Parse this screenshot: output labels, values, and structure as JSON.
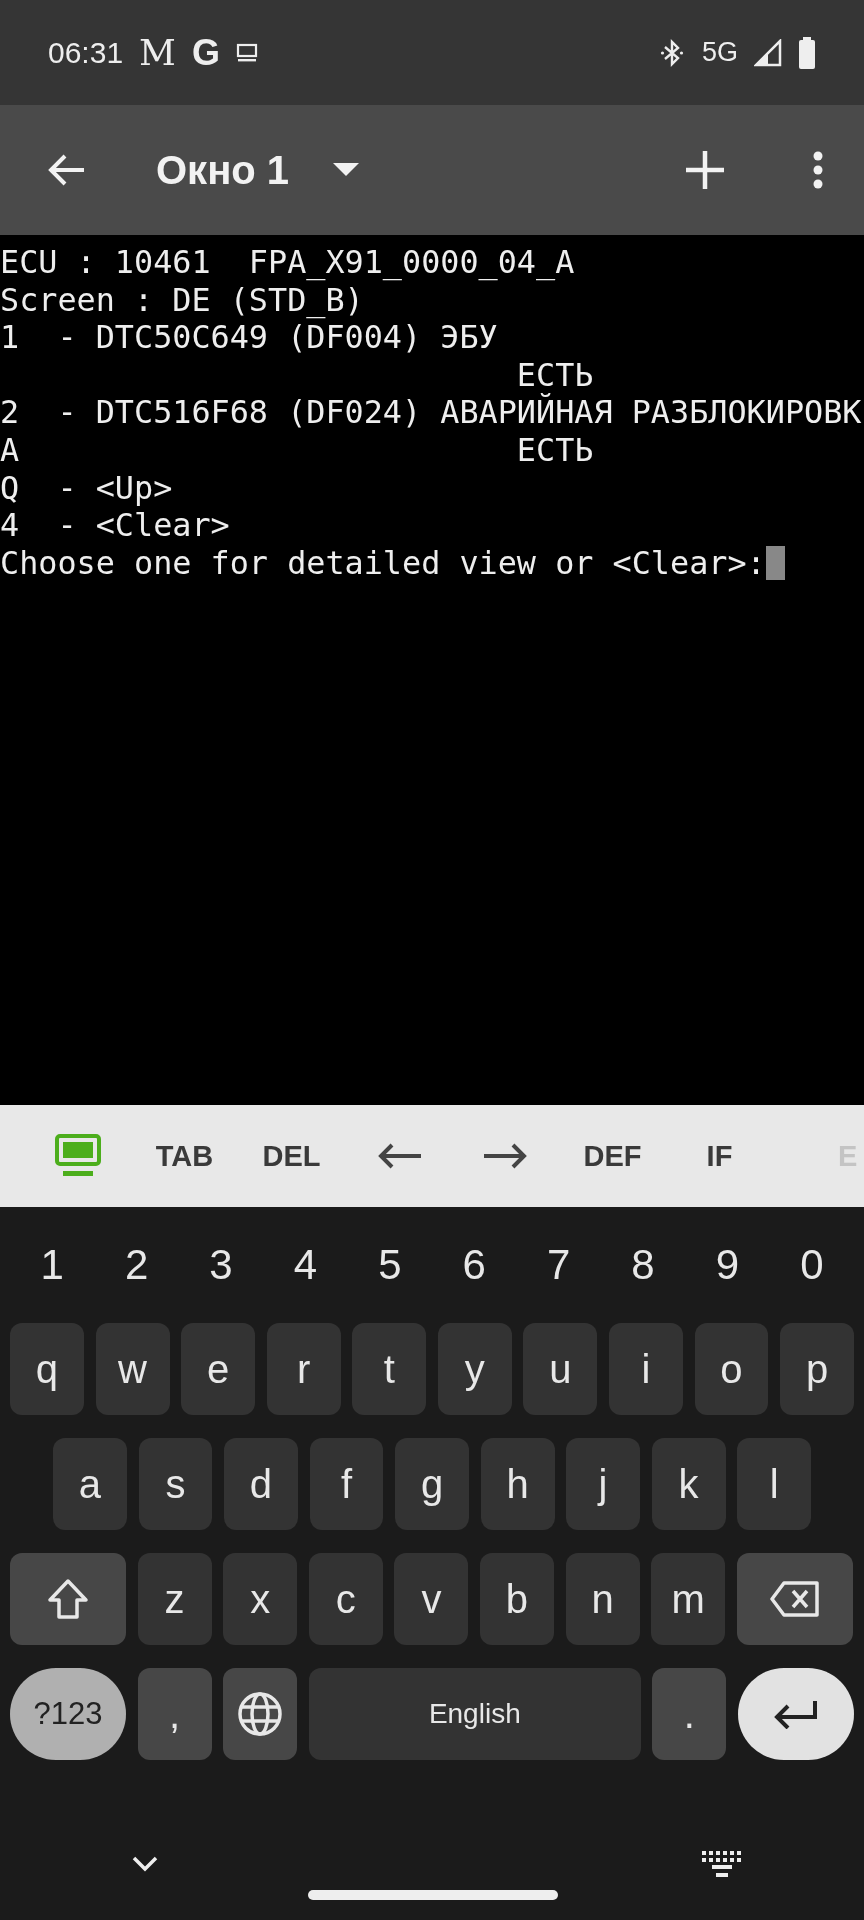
{
  "status_bar": {
    "time": "06:31",
    "notification_glyphs": [
      "M",
      "G"
    ],
    "network": "5G"
  },
  "app_bar": {
    "title": "Окно 1"
  },
  "terminal": {
    "lines": [
      "ECU : 10461  FPA_X91_0000_04_A",
      "Screen : DE (STD_B)",
      "1  - DTC50C649 (DF004) ЭБУ",
      "                           ЕСТЬ",
      "2  - DTC516F68 (DF024) АВАРИЙНАЯ РАЗБЛОКИРОВК",
      "A                          ЕСТЬ",
      "Q  - <Up>",
      "4  - <Clear>",
      "Choose one for detailed view or <Clear>:"
    ]
  },
  "extra_keys": [
    {
      "kind": "keyboard"
    },
    {
      "kind": "text",
      "label": "TAB"
    },
    {
      "kind": "text",
      "label": "DEL"
    },
    {
      "kind": "left"
    },
    {
      "kind": "right"
    },
    {
      "kind": "text",
      "label": "DEF"
    },
    {
      "kind": "text",
      "label": "IF"
    },
    {
      "kind": "partial",
      "label": "E"
    }
  ],
  "keyboard": {
    "number_row": [
      "1",
      "2",
      "3",
      "4",
      "5",
      "6",
      "7",
      "8",
      "9",
      "0"
    ],
    "rows": [
      {
        "keys": [
          {
            "kind": "letter",
            "label": "q"
          },
          {
            "kind": "letter",
            "label": "w"
          },
          {
            "kind": "letter",
            "label": "e"
          },
          {
            "kind": "letter",
            "label": "r"
          },
          {
            "kind": "letter",
            "label": "t"
          },
          {
            "kind": "letter",
            "label": "y"
          },
          {
            "kind": "letter",
            "label": "u"
          },
          {
            "kind": "letter",
            "label": "i"
          },
          {
            "kind": "letter",
            "label": "o"
          },
          {
            "kind": "letter",
            "label": "p"
          }
        ]
      },
      {
        "keys": [
          {
            "kind": "letter",
            "label": "a"
          },
          {
            "kind": "letter",
            "label": "s"
          },
          {
            "kind": "letter",
            "label": "d"
          },
          {
            "kind": "letter",
            "label": "f"
          },
          {
            "kind": "letter",
            "label": "g"
          },
          {
            "kind": "letter",
            "label": "h"
          },
          {
            "kind": "letter",
            "label": "j"
          },
          {
            "kind": "letter",
            "label": "k"
          },
          {
            "kind": "letter",
            "label": "l"
          }
        ]
      },
      {
        "keys": [
          {
            "kind": "shift"
          },
          {
            "kind": "letter",
            "label": "z"
          },
          {
            "kind": "letter",
            "label": "x"
          },
          {
            "kind": "letter",
            "label": "c"
          },
          {
            "kind": "letter",
            "label": "v"
          },
          {
            "kind": "letter",
            "label": "b"
          },
          {
            "kind": "letter",
            "label": "n"
          },
          {
            "kind": "letter",
            "label": "m"
          },
          {
            "kind": "backspace"
          }
        ]
      },
      {
        "keys": [
          {
            "kind": "symbols",
            "label": "?123"
          },
          {
            "kind": "punct",
            "label": ","
          },
          {
            "kind": "globe"
          },
          {
            "kind": "space",
            "label": "English"
          },
          {
            "kind": "punct",
            "label": "."
          },
          {
            "kind": "enter"
          }
        ]
      }
    ]
  }
}
